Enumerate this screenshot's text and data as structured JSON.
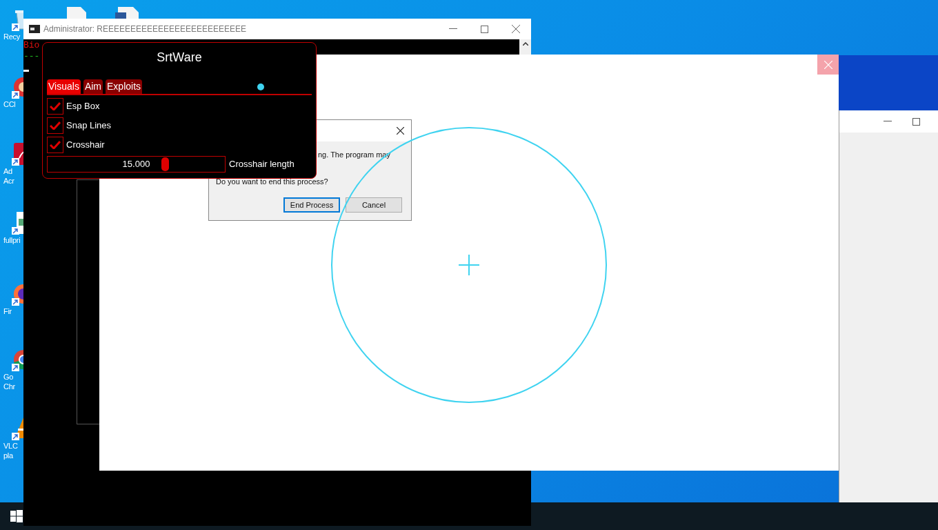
{
  "desktop_icons": [
    {
      "kind": "recycle",
      "lines": [
        "Recy"
      ]
    },
    {
      "kind": "app",
      "lines": [
        "CCl"
      ]
    },
    {
      "kind": "pdf",
      "lines": [
        "Ad",
        "Acr"
      ]
    },
    {
      "kind": "image",
      "lines": [
        "fullpri"
      ]
    },
    {
      "kind": "browser",
      "lines": [
        "Fir"
      ]
    },
    {
      "kind": "browser2",
      "lines": [
        "Go",
        "Chr"
      ]
    },
    {
      "kind": "cone",
      "lines": [
        "VLC",
        "pla"
      ]
    }
  ],
  "console": {
    "title": "Administrator:  REEEEEEEEEEEEEEEEEEEEEEEEEE",
    "lines": [
      {
        "text": "Bio",
        "kind": "alert"
      },
      {
        "text": "---",
        "kind": "rule"
      }
    ]
  },
  "dialog": {
    "lines": [
      "ng. The program may",
      "Do you want to end this process?"
    ],
    "buttons": [
      {
        "label": "End Process",
        "selected": true
      },
      {
        "label": "Cancel",
        "selected": false
      }
    ]
  },
  "menu": {
    "title": "SrtWare",
    "tabs": [
      {
        "label": "Visuals",
        "selected": true
      },
      {
        "label": "Aim",
        "selected": false
      },
      {
        "label": "Exploits",
        "selected": false
      }
    ],
    "options": [
      {
        "label": "Esp Box",
        "checked": true
      },
      {
        "label": "Snap Lines",
        "checked": true
      },
      {
        "label": "Crosshair",
        "checked": true
      }
    ],
    "slider": {
      "value": "15.000",
      "level": 0.66,
      "label": "Crosshair length"
    }
  }
}
